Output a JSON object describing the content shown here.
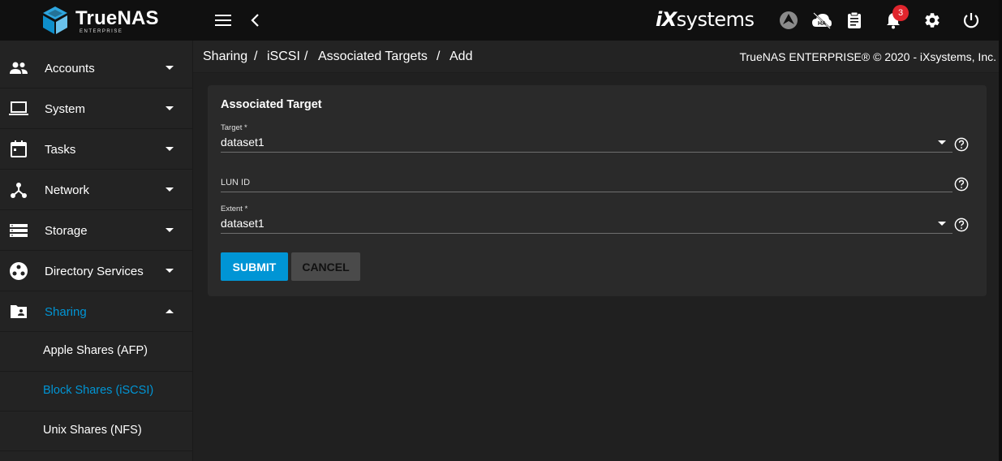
{
  "app": {
    "logo_text": "TrueNAS",
    "logo_subtitle": "ENTERPRISE",
    "vendor_logo_ix": "iX",
    "vendor_logo_rest": "systems",
    "notification_count": "3",
    "ha_label": "HA"
  },
  "sidebar": {
    "items": [
      {
        "label": "Accounts",
        "icon": "people-icon"
      },
      {
        "label": "System",
        "icon": "laptop-icon"
      },
      {
        "label": "Tasks",
        "icon": "calendar-icon"
      },
      {
        "label": "Network",
        "icon": "network-icon"
      },
      {
        "label": "Storage",
        "icon": "storage-icon"
      },
      {
        "label": "Directory Services",
        "icon": "directory-icon"
      },
      {
        "label": "Sharing",
        "icon": "folder-shared-icon"
      }
    ],
    "sub_items": [
      {
        "label": "Apple Shares (AFP)"
      },
      {
        "label": "Block Shares (iSCSI)"
      },
      {
        "label": "Unix Shares (NFS)"
      }
    ]
  },
  "breadcrumb": {
    "items": [
      "Sharing",
      "iSCSI",
      "Associated Targets",
      "Add"
    ],
    "separator": "/"
  },
  "copyright": "TrueNAS ENTERPRISE® © 2020 - iXsystems, Inc.",
  "form": {
    "title": "Associated Target",
    "target_label": "Target *",
    "target_value": "dataset1",
    "lun_label": "LUN ID",
    "extent_label": "Extent *",
    "extent_value": "dataset1",
    "submit_label": "SUBMIT",
    "cancel_label": "CANCEL"
  },
  "colors": {
    "accent": "#0095d5",
    "badge": "#e0252d"
  }
}
